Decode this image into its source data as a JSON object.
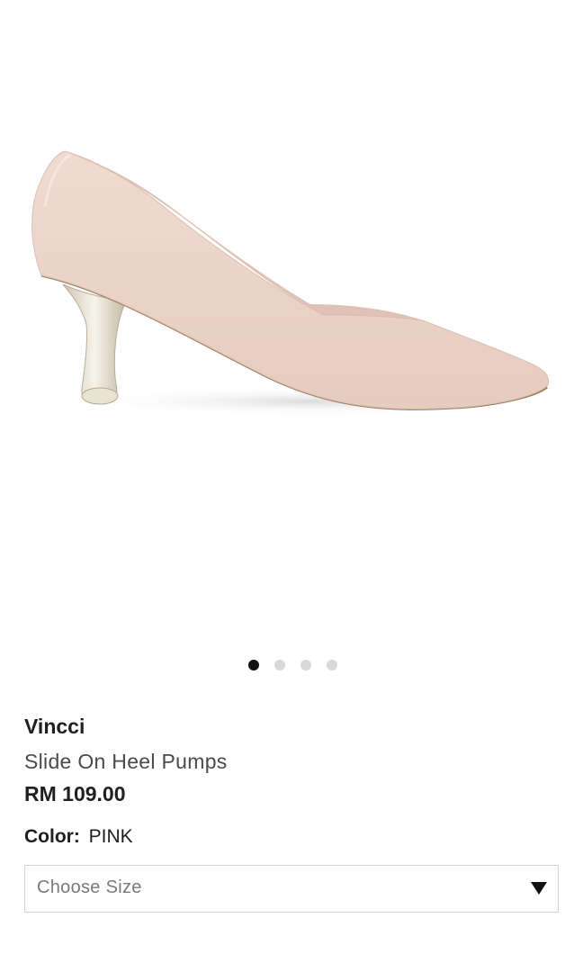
{
  "gallery": {
    "image_icon": "high-heel-pump-photo",
    "dots": [
      {
        "active": true
      },
      {
        "active": false
      },
      {
        "active": false
      },
      {
        "active": false
      }
    ]
  },
  "product": {
    "brand": "Vincci",
    "name": "Slide On Heel Pumps",
    "price": "RM 109.00"
  },
  "color": {
    "label": "Color:",
    "value": "PINK"
  },
  "size_select": {
    "placeholder": "Choose Size",
    "caret_icon": "caret-down-icon"
  },
  "colors": {
    "shoe": "#ecd3c8",
    "active_dot": "#111111",
    "inactive_dot": "#d9d9d9"
  }
}
